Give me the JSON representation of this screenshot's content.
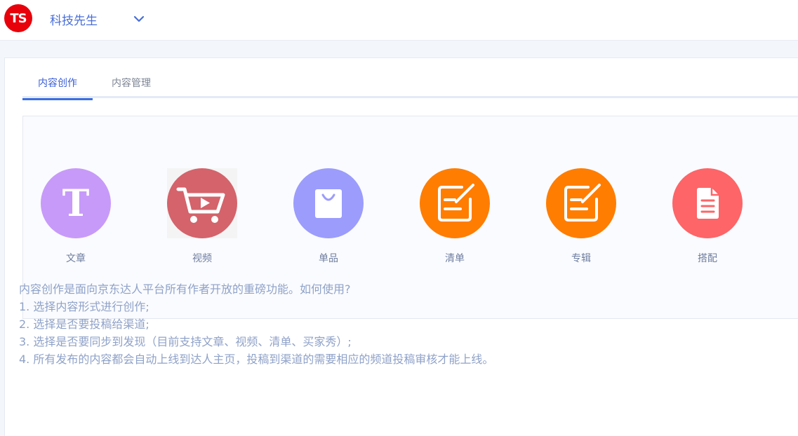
{
  "header": {
    "logo_text": "TS",
    "shop_name": "科技先生",
    "dropdown_icon": "chevron-down-icon"
  },
  "tabs": [
    {
      "label": "内容创作",
      "active": true
    },
    {
      "label": "内容管理",
      "active": false
    }
  ],
  "content_types": [
    {
      "label": "文章",
      "icon": "text-t-icon",
      "color": "#c79af9"
    },
    {
      "label": "视频",
      "icon": "cart-video-icon",
      "color": "#d4636b"
    },
    {
      "label": "单品",
      "icon": "shopping-bag-icon",
      "color": "#9b9cfc"
    },
    {
      "label": "清单",
      "icon": "edit-list-icon",
      "color": "#ff7d00"
    },
    {
      "label": "专辑",
      "icon": "edit-album-icon",
      "color": "#ff7d00"
    },
    {
      "label": "搭配",
      "icon": "document-icon",
      "color": "#fd6568"
    }
  ],
  "help": {
    "intro": "内容创作是面向京东达人平台所有作者开放的重磅功能。如何使用?",
    "steps": [
      "1. 选择内容形式进行创作;",
      "2. 选择是否要投稿给渠道;",
      "3. 选择是否要同步到发现（目前支持文章、视频、清单、买家秀）;",
      "4. 所有发布的内容都会自动上线到达人主页，投稿到渠道的需要相应的频道投稿审核才能上线。"
    ]
  },
  "colors": {
    "accent": "#3b6ee3",
    "logo_red": "#e8000b",
    "help_text": "#8fa2c8"
  }
}
